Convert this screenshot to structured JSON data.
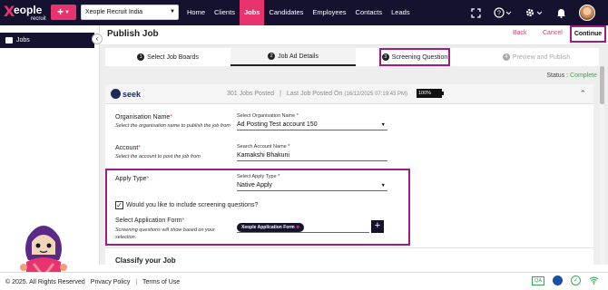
{
  "app": {
    "logo_text": "eople",
    "logo_sub": "recruit",
    "add_label": "+",
    "org_select": "Xeople Recruit India"
  },
  "nav": {
    "items": [
      "Home",
      "Clients",
      "Jobs",
      "Candidates",
      "Employees",
      "Contacts",
      "Leads"
    ],
    "active": "Jobs"
  },
  "top_icons": [
    "fullscreen-icon",
    "help-icon",
    "settings-icon",
    "bell-icon",
    "avatar"
  ],
  "sidebar": {
    "items": [
      {
        "label": "Jobs",
        "icon": "briefcase-icon"
      }
    ]
  },
  "header": {
    "title": "Publish Job",
    "back": "Back",
    "cancel": "Cancel",
    "continue": "Continue"
  },
  "steps": [
    {
      "num": "1",
      "label": "Select Job Boards",
      "state": "done"
    },
    {
      "num": "2",
      "label": "Job Ad Details",
      "state": "active"
    },
    {
      "num": "3",
      "label": "Screening Question",
      "state": "highlight"
    },
    {
      "num": "4",
      "label": "Preview and Publish",
      "state": "disabled"
    }
  ],
  "status": {
    "label": "Status : ",
    "value": "Complete"
  },
  "board": {
    "name": "seek",
    "jobs_posted": "301 Jobs Posted",
    "last_posted_label": "Last Job Posted On",
    "last_posted_date": "(16/12/2025 07:19:43 PM)",
    "percent": "100%"
  },
  "form": {
    "org": {
      "label": "Organisation Name",
      "help": "Select the organisation name to publish the job from",
      "select_label": "Select Organisation Name *",
      "value": "Ad Posting Test account 150"
    },
    "account": {
      "label": "Account",
      "help": "Select the account to post the job from",
      "select_label": "Search Account Name *",
      "value": "Kamakshi Bhakuni"
    },
    "apply": {
      "label": "Apply Type",
      "select_label": "Select Apply Type *",
      "value": "Native Apply"
    },
    "screening_checkbox": {
      "label": "Would you like to include screening questions?",
      "checked": true
    },
    "application_form": {
      "label": "Select Application Form",
      "help": "Screening questions will show based on your selection.",
      "chip": "Xeople Application Form"
    }
  },
  "section_next": "Classify your Job",
  "footer": {
    "copyright": "© 2025. All Rights Reserved",
    "privacy": "Privacy Policy",
    "terms": "Terms of Use",
    "qa": "QA"
  },
  "colors": {
    "brand_pink": "#e8336e",
    "navy": "#14122f",
    "highlight_purple": "#9c1c8c",
    "success_green": "#3aa655"
  }
}
